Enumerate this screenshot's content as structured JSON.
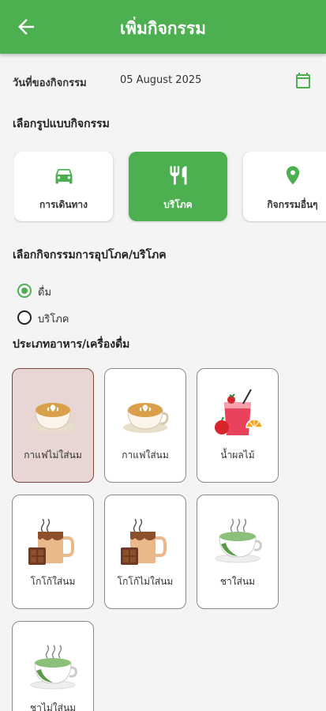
{
  "appbar": {
    "title": "เพิ่มกิจกรรม",
    "back_icon": "arrow-left-icon"
  },
  "date": {
    "label": "วันที่ของกิจกรรม",
    "value": "05 August 2025",
    "icon": "calendar-icon"
  },
  "activity_type": {
    "heading": "เลือกรูปแบบกิจกรรม",
    "tabs": [
      {
        "label": "การเดินทาง",
        "icon": "car-icon",
        "selected": false
      },
      {
        "label": "บริโภค",
        "icon": "fork-knife-icon",
        "selected": true
      },
      {
        "label": "กิจกรรมอื่นๆ",
        "icon": "location-pin-icon",
        "selected": false
      }
    ]
  },
  "consumption": {
    "heading": "เลือกกิจกรรมการอุปโภค/บริโภค",
    "options": [
      {
        "label": "ดื่ม",
        "checked": true
      },
      {
        "label": "บริโภค",
        "checked": false
      }
    ]
  },
  "food_type": {
    "heading": "ประเภทอาหาร/เครื่องดื่ม",
    "items": [
      {
        "label": "กาแฟไม่ใส่นม",
        "icon": "latte-cup-icon",
        "selected": true
      },
      {
        "label": "กาแฟใส่นม",
        "icon": "latte-cup-icon",
        "selected": false
      },
      {
        "label": "น้ำผลไม้",
        "icon": "fruit-juice-icon",
        "selected": false
      },
      {
        "label": "โกโก้ใส่นม",
        "icon": "cocoa-mug-icon",
        "selected": false
      },
      {
        "label": "โกโก้ไม่ใส่นม",
        "icon": "cocoa-mug-icon",
        "selected": false
      },
      {
        "label": "ชาใส่นม",
        "icon": "green-tea-cup-icon",
        "selected": false
      },
      {
        "label": "ชาไม่ใส่นม",
        "icon": "green-tea-cup-icon",
        "selected": false
      }
    ]
  },
  "colors": {
    "primary": "#4caf50",
    "selected_card_bg": "#e7d6d3",
    "selected_card_border": "#7b4a3a"
  }
}
